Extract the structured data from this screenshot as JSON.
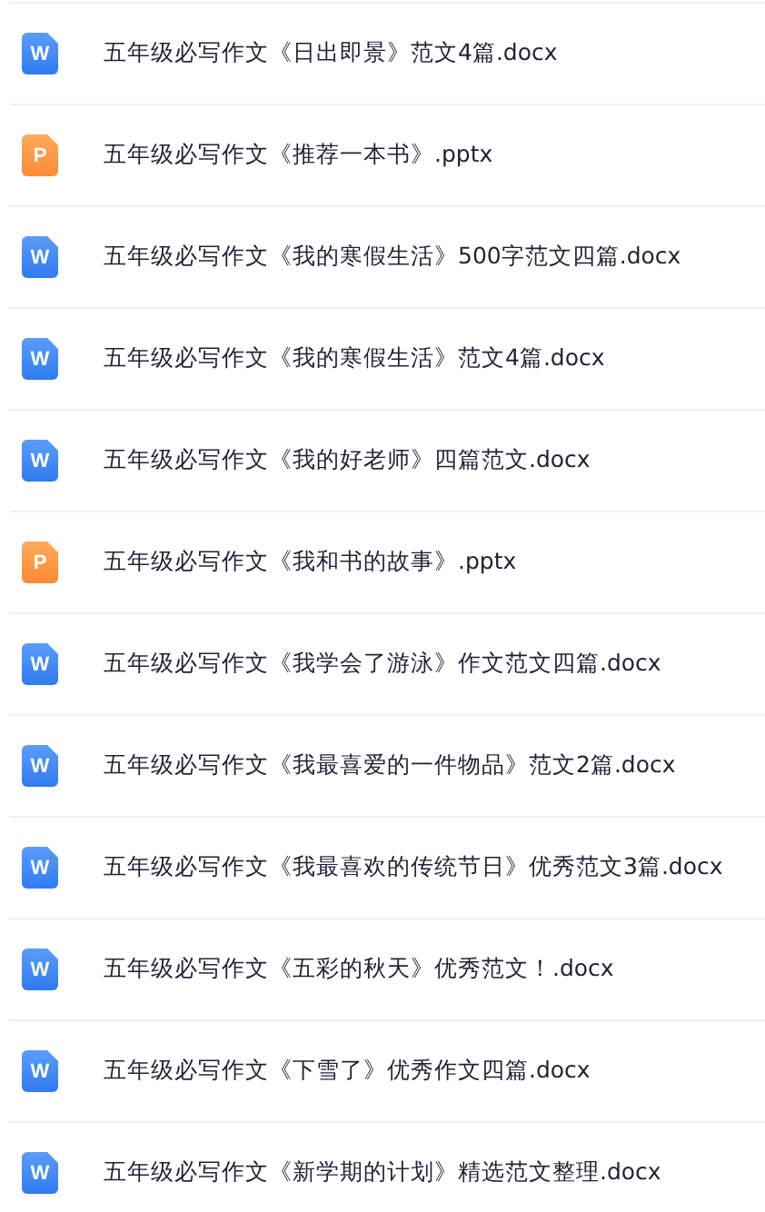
{
  "files": [
    {
      "kind": "docx",
      "icon_letter": "W",
      "name": "五年级必写作文《日出即景》范文4篇.docx"
    },
    {
      "kind": "pptx",
      "icon_letter": "P",
      "name": "五年级必写作文《推荐一本书》.pptx"
    },
    {
      "kind": "docx",
      "icon_letter": "W",
      "name": "五年级必写作文《我的寒假生活》500字范文四篇.docx"
    },
    {
      "kind": "docx",
      "icon_letter": "W",
      "name": "五年级必写作文《我的寒假生活》范文4篇.docx"
    },
    {
      "kind": "docx",
      "icon_letter": "W",
      "name": "五年级必写作文《我的好老师》四篇范文.docx"
    },
    {
      "kind": "pptx",
      "icon_letter": "P",
      "name": "五年级必写作文《我和书的故事》.pptx"
    },
    {
      "kind": "docx",
      "icon_letter": "W",
      "name": "五年级必写作文《我学会了游泳》作文范文四篇.docx"
    },
    {
      "kind": "docx",
      "icon_letter": "W",
      "name": "五年级必写作文《我最喜爱的一件物品》范文2篇.docx"
    },
    {
      "kind": "docx",
      "icon_letter": "W",
      "name": "五年级必写作文《我最喜欢的传统节日》优秀范文3篇.docx"
    },
    {
      "kind": "docx",
      "icon_letter": "W",
      "name": "五年级必写作文《五彩的秋天》优秀范文！.docx"
    },
    {
      "kind": "docx",
      "icon_letter": "W",
      "name": "五年级必写作文《下雪了》优秀作文四篇.docx"
    },
    {
      "kind": "docx",
      "icon_letter": "W",
      "name": "五年级必写作文《新学期的计划》精选范文整理.docx"
    }
  ]
}
